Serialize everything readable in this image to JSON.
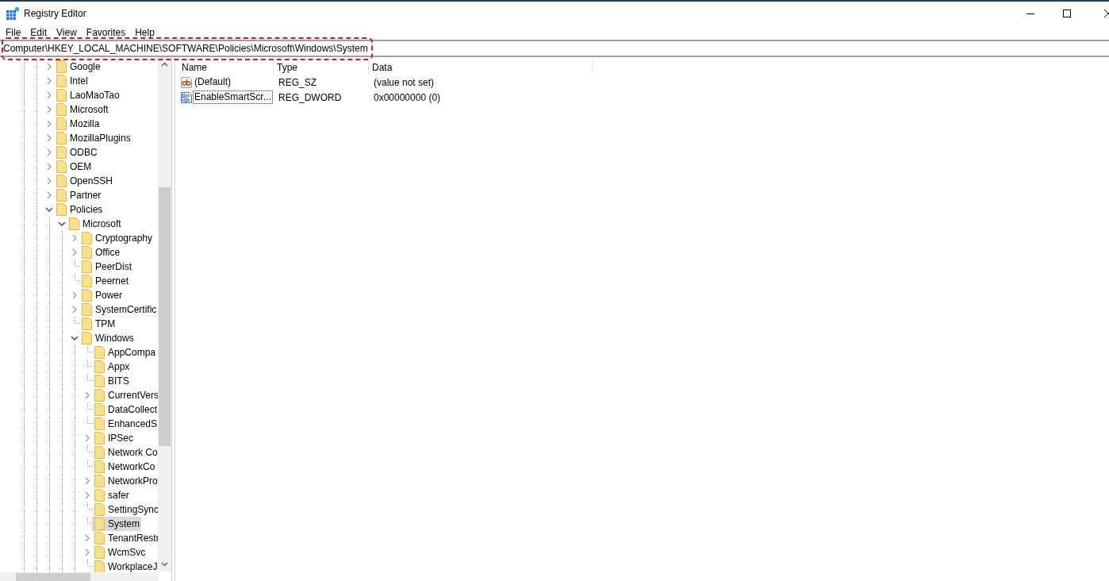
{
  "window": {
    "title": "Registry Editor"
  },
  "menu": [
    "File",
    "Edit",
    "View",
    "Favorites",
    "Help"
  ],
  "address": "Computer\\HKEY_LOCAL_MACHINE\\SOFTWARE\\Policies\\Microsoft\\Windows\\System",
  "tree": [
    {
      "label": "Google",
      "kind": "collapsed",
      "selected": false
    },
    {
      "label": "Intel",
      "kind": "collapsed",
      "selected": false
    },
    {
      "label": "LaoMaoTao",
      "kind": "collapsed",
      "selected": false
    },
    {
      "label": "Microsoft",
      "kind": "collapsed",
      "selected": false
    },
    {
      "label": "Mozilla",
      "kind": "collapsed",
      "selected": false
    },
    {
      "label": "MozillaPlugins",
      "kind": "collapsed",
      "selected": false
    },
    {
      "label": "ODBC",
      "kind": "collapsed",
      "selected": false
    },
    {
      "label": "OEM",
      "kind": "collapsed",
      "selected": false
    },
    {
      "label": "OpenSSH",
      "kind": "collapsed",
      "selected": false
    },
    {
      "label": "Partner",
      "kind": "collapsed",
      "selected": false
    },
    {
      "label": "Policies",
      "kind": "expanded",
      "selected": false,
      "children": [
        {
          "label": "Microsoft",
          "kind": "expanded",
          "selected": false,
          "children": [
            {
              "label": "Cryptography",
              "kind": "collapsed",
              "selected": false
            },
            {
              "label": "Office",
              "kind": "collapsed",
              "selected": false
            },
            {
              "label": "PeerDist",
              "kind": "leaf",
              "selected": false
            },
            {
              "label": "Peernet",
              "kind": "leaf",
              "selected": false
            },
            {
              "label": "Power",
              "kind": "collapsed",
              "selected": false
            },
            {
              "label": "SystemCertific",
              "kind": "collapsed",
              "selected": false
            },
            {
              "label": "TPM",
              "kind": "leaf",
              "selected": false
            },
            {
              "label": "Windows",
              "kind": "expanded",
              "selected": false,
              "children": [
                {
                  "label": "AppCompa",
                  "kind": "leaf",
                  "selected": false
                },
                {
                  "label": "Appx",
                  "kind": "leaf",
                  "selected": false
                },
                {
                  "label": "BITS",
                  "kind": "leaf",
                  "selected": false
                },
                {
                  "label": "CurrentVers",
                  "kind": "collapsed",
                  "selected": false
                },
                {
                  "label": "DataCollect",
                  "kind": "leaf",
                  "selected": false
                },
                {
                  "label": "EnhancedS",
                  "kind": "leaf",
                  "selected": false
                },
                {
                  "label": "IPSec",
                  "kind": "collapsed",
                  "selected": false
                },
                {
                  "label": "Network Co",
                  "kind": "leaf",
                  "selected": false
                },
                {
                  "label": "NetworkCo",
                  "kind": "leaf",
                  "selected": false
                },
                {
                  "label": "NetworkPro",
                  "kind": "collapsed",
                  "selected": false
                },
                {
                  "label": "safer",
                  "kind": "collapsed",
                  "selected": false
                },
                {
                  "label": "SettingSync",
                  "kind": "leaf",
                  "selected": false
                },
                {
                  "label": "System",
                  "kind": "leaf",
                  "selected": true
                },
                {
                  "label": "TenantRestr",
                  "kind": "collapsed",
                  "selected": false
                },
                {
                  "label": "WcmSvc",
                  "kind": "collapsed",
                  "selected": false
                },
                {
                  "label": "WorkplaceJ",
                  "kind": "leaf",
                  "selected": false
                }
              ]
            }
          ]
        }
      ]
    }
  ],
  "values": {
    "columns": [
      "Name",
      "Type",
      "Data"
    ],
    "rows": [
      {
        "kind": "string",
        "name": "(Default)",
        "type": "REG_SZ",
        "data": "(value not set)",
        "focused": false
      },
      {
        "kind": "binary",
        "name": "EnableSmartScr...",
        "type": "REG_DWORD",
        "data": "0x00000000 (0)",
        "focused": true
      }
    ]
  }
}
